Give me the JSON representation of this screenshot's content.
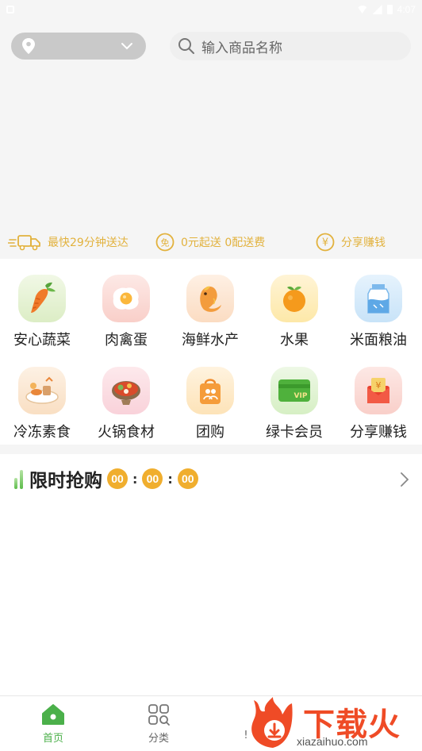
{
  "status_bar": {
    "time": "4:07"
  },
  "header": {
    "location_value": "",
    "search_placeholder": "输入商品名称"
  },
  "features": [
    {
      "icon": "delivery-truck-icon",
      "label": "最快29分钟送达"
    },
    {
      "icon": "free-shipping-icon",
      "label": "0元起送 0配送费"
    },
    {
      "icon": "yen-coin-icon",
      "label": "分享赚钱"
    }
  ],
  "categories": [
    {
      "label": "安心蔬菜",
      "icon": "carrot-icon"
    },
    {
      "label": "肉禽蛋",
      "icon": "egg-icon"
    },
    {
      "label": "海鲜水产",
      "icon": "fish-icon"
    },
    {
      "label": "水果",
      "icon": "orange-icon"
    },
    {
      "label": "米面粮油",
      "icon": "milk-carton-icon"
    },
    {
      "label": "冷冻素食",
      "icon": "frozen-food-icon"
    },
    {
      "label": "火锅食材",
      "icon": "hotpot-icon"
    },
    {
      "label": "团购",
      "icon": "group-buy-bag-icon"
    },
    {
      "label": "绿卡会员",
      "icon": "vip-card-icon"
    },
    {
      "label": "分享赚钱",
      "icon": "red-envelope-icon"
    }
  ],
  "flash_sale": {
    "title": "限时抢购",
    "hours": "00",
    "minutes": "00",
    "seconds": "00",
    "separator": ":"
  },
  "tab_bar": {
    "home": "首页",
    "category": "分类",
    "third": "!"
  },
  "watermark": {
    "text": "下载火",
    "url": "xiazaihuo.com"
  },
  "colors": {
    "accent_green": "#4bb04a",
    "feature_gold": "#e2b23e",
    "timer_orange": "#f0ae2e",
    "watermark_red": "#ef4b26"
  }
}
